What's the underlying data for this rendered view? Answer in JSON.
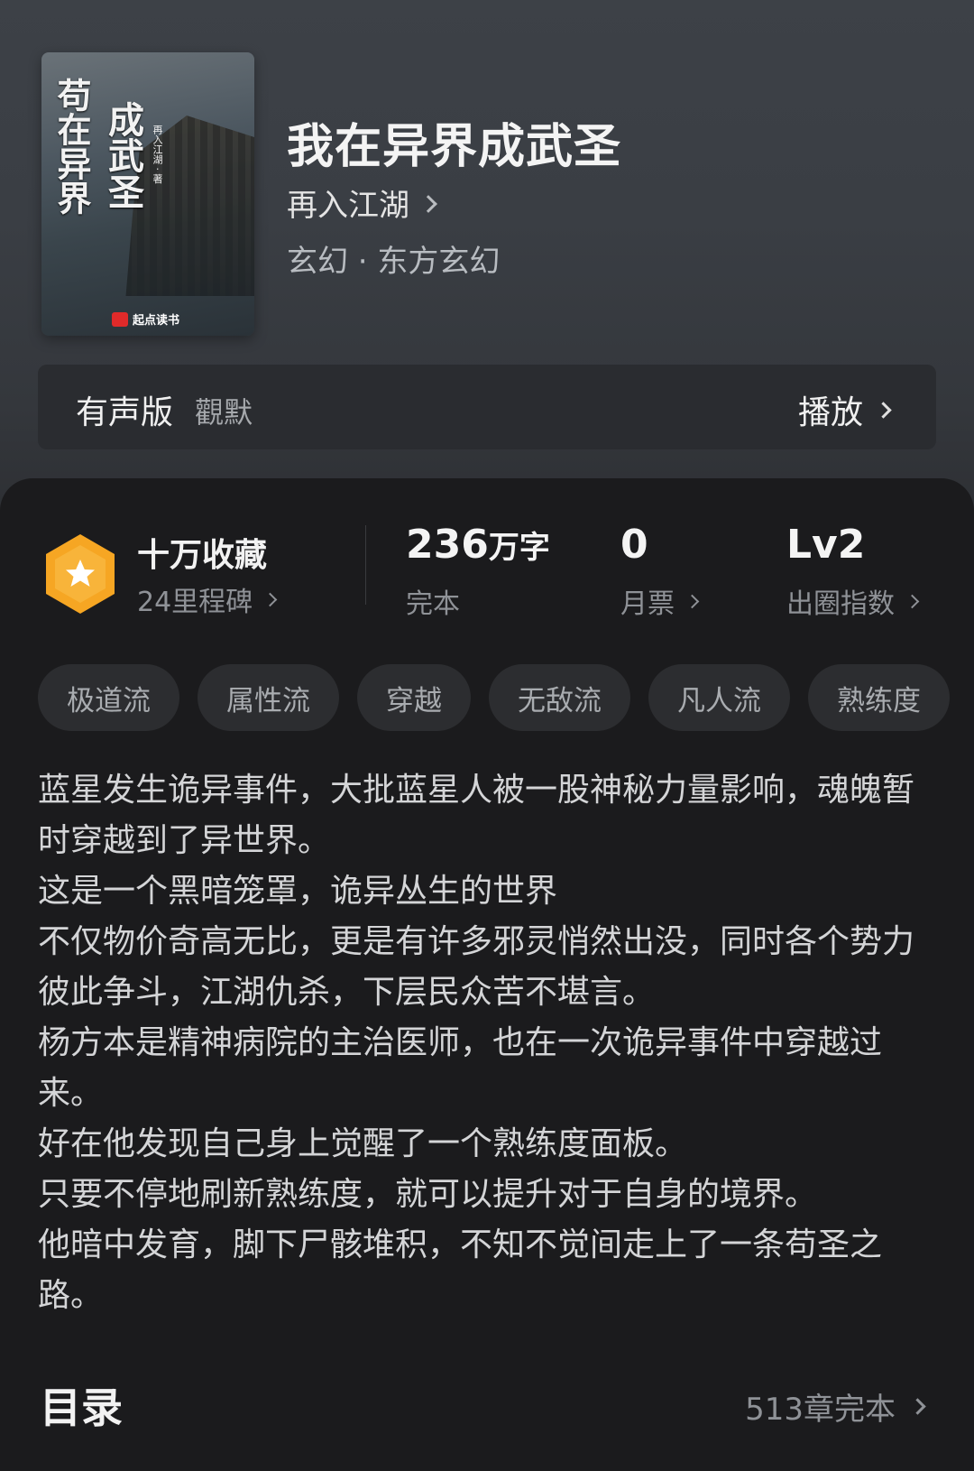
{
  "book": {
    "cover": {
      "title_line1": "苟在异界",
      "title_line2": "成武圣",
      "author_small": "再入江湖 · 著",
      "brand": "起点读书"
    },
    "title": "我在异界成武圣",
    "author": "再入江湖",
    "genre": "玄幻 · 东方玄幻"
  },
  "audio": {
    "label": "有声版",
    "narrator": "觀默",
    "play_label": "播放"
  },
  "stats": {
    "collect_title": "十万收藏",
    "collect_sub": "24里程碑",
    "words_value": "236",
    "words_unit": "万字",
    "words_label": "完本",
    "monthly_value": "0",
    "monthly_label": "月票",
    "level_value": "Lv2",
    "level_label": "出圈指数"
  },
  "tags": [
    "极道流",
    "属性流",
    "穿越",
    "无敌流",
    "凡人流",
    "熟练度"
  ],
  "description": "蓝星发生诡异事件，大批蓝星人被一股神秘力量影响，魂魄暂时穿越到了异世界。\n这是一个黑暗笼罩，诡异丛生的世界\n不仅物价奇高无比，更是有许多邪灵悄然出没，同时各个势力彼此争斗，江湖仇杀，下层民众苦不堪言。\n杨方本是精神病院的主治医师，也在一次诡异事件中穿越过来。\n好在他发现自己身上觉醒了一个熟练度面板。\n只要不停地刷新熟练度，就可以提升对于自身的境界。\n他暗中发育，脚下尸骸堆积，不知不觉间走上了一条苟圣之路。",
  "toc": {
    "label": "目录",
    "status": "513章完本"
  },
  "colors": {
    "badge_orange": "#f6a623",
    "background": "#1b1b1d"
  }
}
